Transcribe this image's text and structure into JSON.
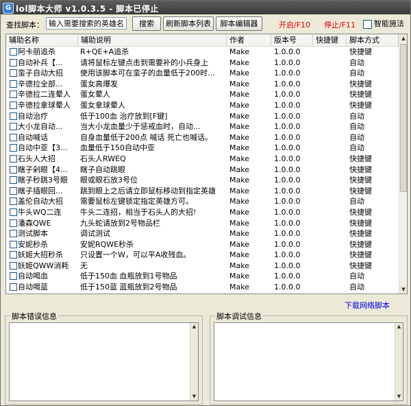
{
  "window": {
    "title": "lol脚本大师 v1.0.3.5 - 脚本已停止",
    "icon_letter": "G"
  },
  "toolbar": {
    "search_label": "查找脚本：",
    "search_value": "输入需要搜索的英雄名",
    "search_button": "搜索",
    "refresh_button": "刷新脚本列表",
    "editor_button": "脚本编辑器",
    "start_label": "开启/F10",
    "stop_label": "停止/F11",
    "smart_cast_label": "智能施法"
  },
  "colors": {
    "accent_red": "#e00000",
    "link_blue": "#0000e0"
  },
  "table": {
    "columns": [
      "辅助名称",
      "辅助说明",
      "作者",
      "版本号",
      "快捷键",
      "脚本方式"
    ],
    "rows": [
      [
        "阿卡丽追杀",
        "R+QE+A追杀",
        "Make",
        "1.0.0.0",
        "",
        "快捷键"
      ],
      [
        "自动补兵【...",
        "请将鼠标左键点击到需要补的小兵身上",
        "Make",
        "1.0.0.0",
        "",
        "自动"
      ],
      [
        "蛮子自动大招",
        "使用该脚本可在蛮子的血量低于200时...",
        "Make",
        "1.0.0.0",
        "",
        "自动"
      ],
      [
        "辛德拉全部...",
        "蛋女高爆发",
        "Make",
        "1.0.0.0",
        "",
        "快捷键"
      ],
      [
        "辛德拉二连晕人",
        "蛋女晕人",
        "Make",
        "1.0.0.0",
        "",
        "快捷键"
      ],
      [
        "辛德拉拿球晕人",
        "蛋女拿球晕人",
        "Make",
        "1.0.0.0",
        "",
        "快捷键"
      ],
      [
        "自动治疗",
        "低于100血 治疗放到[F键]",
        "Make",
        "1.0.0.0",
        "",
        "自动"
      ],
      [
        "大小龙自动...",
        "当大小龙血量少于惩戒血时，自动...",
        "Make",
        "1.0.0.0",
        "",
        "自动"
      ],
      [
        "自动喊话",
        "自身血量低于200点 喊话 死亡也喊话。",
        "Make",
        "1.0.0.0",
        "",
        "自动"
      ],
      [
        "自动中亚【3...",
        "血量低于150自动中亚",
        "Make",
        "1.0.0.0",
        "",
        "自动"
      ],
      [
        "石头人大招",
        "石头人RWEQ",
        "Make",
        "1.0.0.0",
        "",
        "快捷键"
      ],
      [
        "瞎子剁眼【4...",
        "瞎子自动跳眼",
        "Make",
        "1.0.0.0",
        "",
        "快捷键"
      ],
      [
        "瞎子秒跳3号眼",
        "眼或眼石放3号位",
        "Make",
        "1.0.0.0",
        "",
        "快捷键"
      ],
      [
        "瞎子插眼回...",
        "跳到眼上之后请立即鼠标移动到指定英雄",
        "Make",
        "1.0.0.0",
        "",
        "快捷键"
      ],
      [
        "盖伦自动大招",
        "需要鼠标左键锁定指定英雄方可。",
        "Make",
        "1.0.0.0",
        "",
        "自动"
      ],
      [
        "牛头WQ二连",
        "牛头二连招，相当于石头人的大招!",
        "Make",
        "1.0.0.0",
        "",
        "快捷键"
      ],
      [
        "潘森QWE",
        "九头蛇请放到2号物品栏",
        "Make",
        "1.0.0.0",
        "",
        "快捷键"
      ],
      [
        "测试脚本",
        "调试测试",
        "Make",
        "1.0.0.0",
        "",
        "快捷键"
      ],
      [
        "安妮秒杀",
        "安妮RQWE秒杀",
        "Make",
        "1.0.0.0",
        "",
        "快捷键"
      ],
      [
        "妖姬大招秒杀",
        "只设置一个W，可以平A收残血。",
        "Make",
        "1.0.0.0",
        "",
        "快捷键"
      ],
      [
        "妖姬QWW消耗",
        "无",
        "Make",
        "1.0.0.0",
        "",
        "快捷键"
      ],
      [
        "自动喝血",
        "低于150血 血瓶放到1号物品",
        "Make",
        "1.0.0.0",
        "",
        "自动"
      ],
      [
        "自动喝蓝",
        "低于150蓝 蓝瓶放到2号物品",
        "Make",
        "1.0.0.0",
        "",
        "自动"
      ]
    ]
  },
  "download_link": "下载网络脚本",
  "error_panel": {
    "title": "脚本错误信息"
  },
  "debug_panel": {
    "title": "脚本调试信息"
  }
}
